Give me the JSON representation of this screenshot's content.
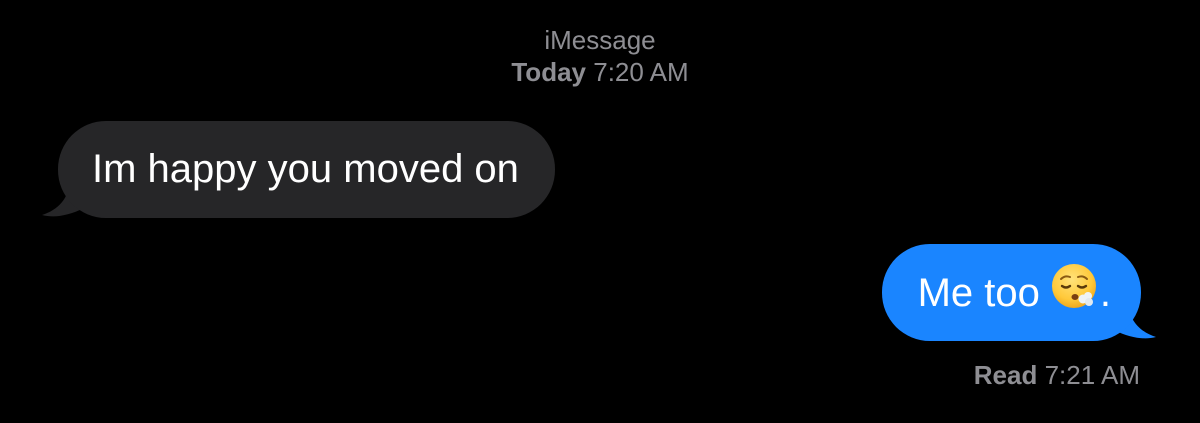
{
  "header": {
    "service_name": "iMessage",
    "day": "Today",
    "time": "7:20 AM"
  },
  "messages": [
    {
      "direction": "incoming",
      "text": "Im happy you moved on"
    },
    {
      "direction": "outgoing",
      "text": "Me too",
      "emoji": "face-exhaling-icon",
      "trailing_text": "."
    }
  ],
  "read_receipt": {
    "label": "Read",
    "time": "7:21 AM"
  },
  "colors": {
    "background": "#000000",
    "incoming_bubble": "#262628",
    "outgoing_bubble": "#1a85ff",
    "secondary_text": "#8e8e93"
  }
}
